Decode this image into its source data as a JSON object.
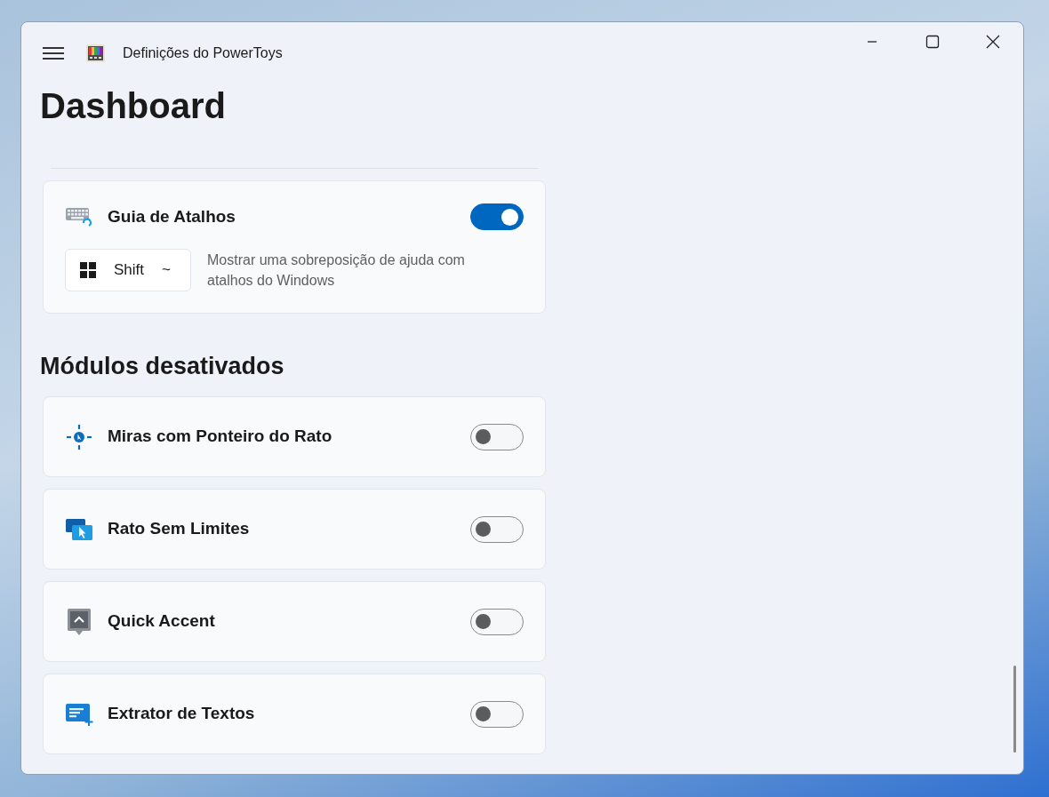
{
  "window": {
    "title": "Definições do PowerToys"
  },
  "page_title": "Dashboard",
  "active_module": {
    "name": "Guia de Atalhos",
    "kind": "keyboard",
    "on": true,
    "shortcut": [
      {
        "kind": "windows-key"
      },
      {
        "kind": "text",
        "label": "Shift"
      },
      {
        "kind": "text",
        "label": "~"
      }
    ],
    "description": "Mostrar uma sobreposição de ajuda com atalhos do Windows"
  },
  "disabled_section": {
    "title": "Módulos desativados",
    "modules": [
      {
        "name": "Miras com Ponteiro do Rato",
        "kind": "crosshairs",
        "on": false
      },
      {
        "name": "Rato Sem Limites",
        "kind": "screens",
        "on": false
      },
      {
        "name": "Quick Accent",
        "kind": "accent",
        "on": false
      },
      {
        "name": "Extrator de Textos",
        "kind": "text-extract",
        "on": false
      }
    ]
  }
}
